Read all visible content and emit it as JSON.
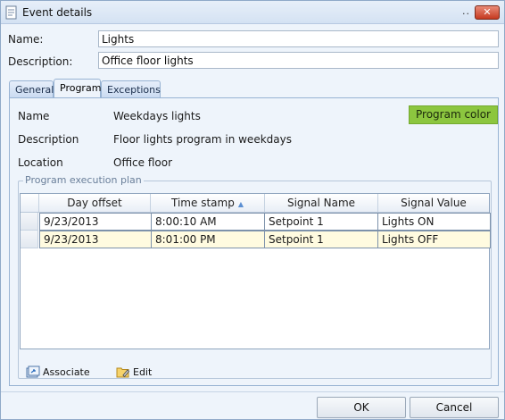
{
  "window": {
    "title": "Event details",
    "title_dots": "..",
    "close_glyph": "✕"
  },
  "form": {
    "name_label": "Name:",
    "name_value": "Lights",
    "description_label": "Description:",
    "description_value": "Office floor lights"
  },
  "tabs": [
    {
      "label": "General",
      "active": false
    },
    {
      "label": "Program",
      "active": true
    },
    {
      "label": "Exceptions",
      "active": false
    }
  ],
  "program": {
    "name_label": "Name",
    "name_value": "Weekdays lights",
    "description_label": "Description",
    "description_value": "Floor lights program in weekdays",
    "location_label": "Location",
    "location_value": "Office floor",
    "color_button": "Program color",
    "color_button_color": "#8cc63f"
  },
  "plan": {
    "legend": "Program execution plan",
    "columns": [
      "Day offset",
      "Time stamp",
      "Signal Name",
      "Signal Value"
    ],
    "sort_icon": "sort-ascending-icon",
    "rows": [
      [
        "9/23/2013",
        "8:00:10 AM",
        "Setpoint 1",
        "Lights ON"
      ],
      [
        "9/23/2013",
        "8:01:00 PM",
        "Setpoint 1",
        "Lights OFF"
      ]
    ],
    "toolbar": {
      "associate_label": "Associate",
      "associate_icon": "associate-icon",
      "edit_label": "Edit",
      "edit_icon": "folder-edit-icon"
    }
  },
  "buttons": {
    "ok": "OK",
    "cancel": "Cancel"
  }
}
